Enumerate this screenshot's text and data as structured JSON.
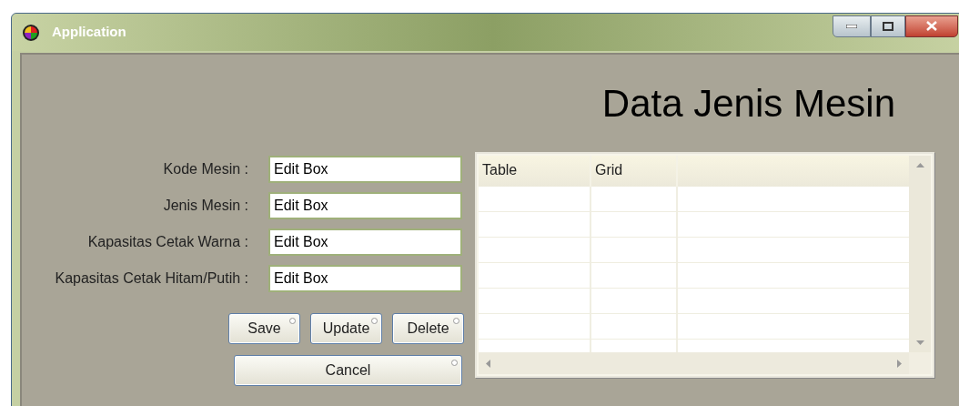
{
  "window": {
    "title": "Application"
  },
  "heading": "Data Jenis Mesin",
  "fields": [
    {
      "label": "Kode Mesin :",
      "value": "Edit Box"
    },
    {
      "label": "Jenis Mesin :",
      "value": "Edit Box"
    },
    {
      "label": "Kapasitas Cetak Warna :",
      "value": "Edit Box"
    },
    {
      "label": "Kapasitas Cetak Hitam/Putih :",
      "value": "Edit Box"
    }
  ],
  "buttons": [
    "Save",
    "Update",
    "Delete"
  ],
  "cancel_button": "Cancel",
  "table": {
    "columns": [
      "Table",
      "Grid"
    ]
  }
}
